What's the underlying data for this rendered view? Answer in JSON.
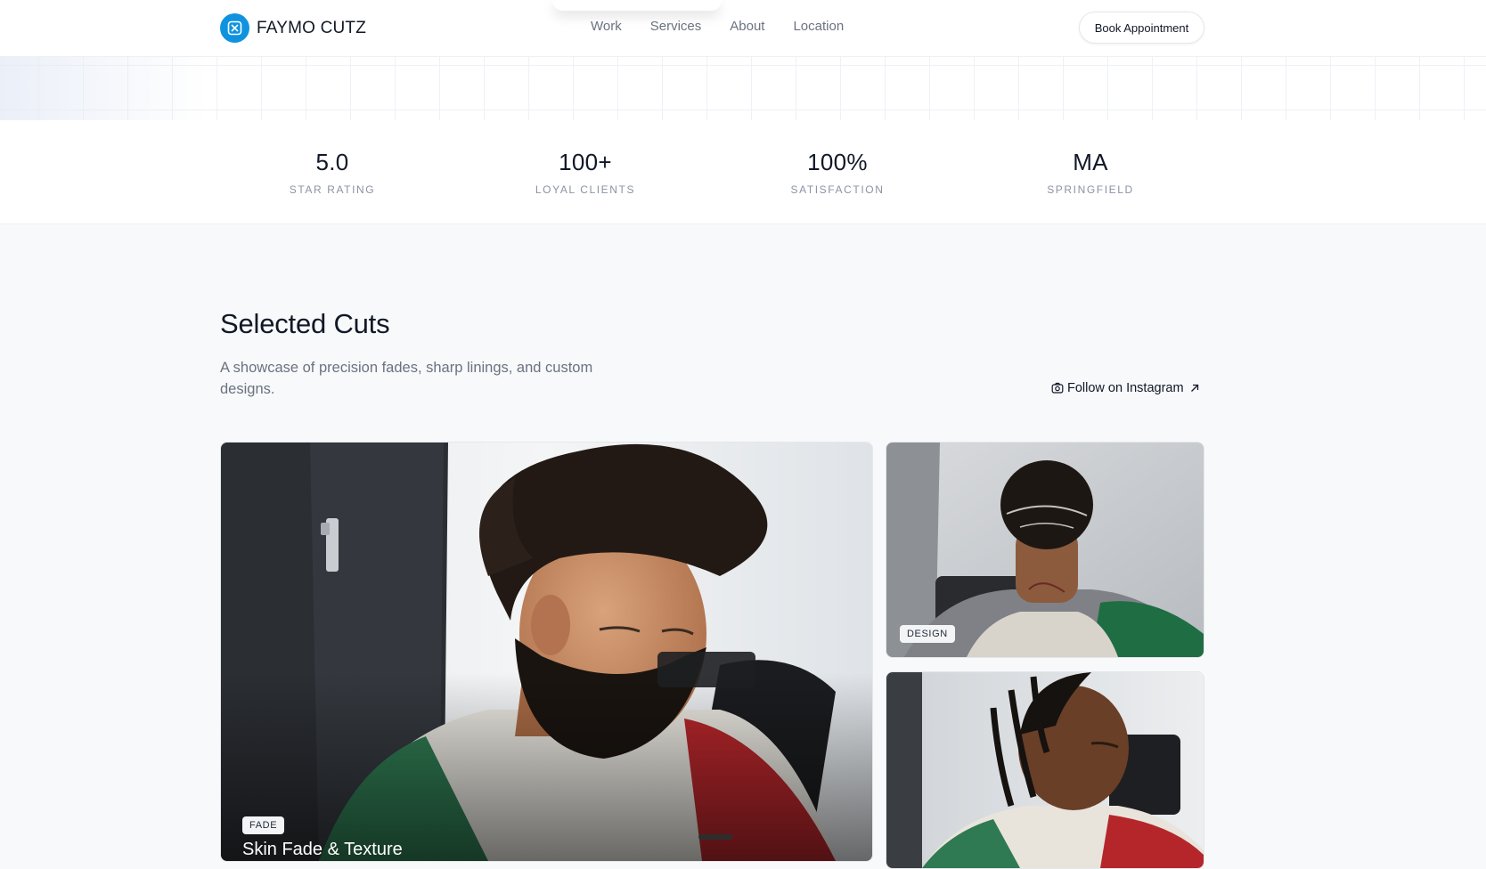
{
  "brand": {
    "name": "FAYMO CUTZ",
    "accent": "#0f93df"
  },
  "nav": {
    "links": [
      "Work",
      "Services",
      "About",
      "Location"
    ],
    "cta": "Book Appointment"
  },
  "stats": [
    {
      "value": "5.0",
      "label": "STAR RATING"
    },
    {
      "value": "100+",
      "label": "LOYAL CLIENTS"
    },
    {
      "value": "100%",
      "label": "SATISFACTION"
    },
    {
      "value": "MA",
      "label": "SPRINGFIELD"
    }
  ],
  "gallery": {
    "title": "Selected Cuts",
    "description": "A showcase of precision fades, sharp linings, and custom designs.",
    "instagram_link": "Follow on Instagram",
    "cards": [
      {
        "badge": "FADE",
        "title": "Skin Fade & Texture"
      },
      {
        "badge": "DESIGN"
      },
      {
        "badge": ""
      }
    ]
  },
  "icons": {
    "logo": "barber-logo-icon",
    "instagram": "camera-icon",
    "external": "arrow-up-right-icon"
  }
}
